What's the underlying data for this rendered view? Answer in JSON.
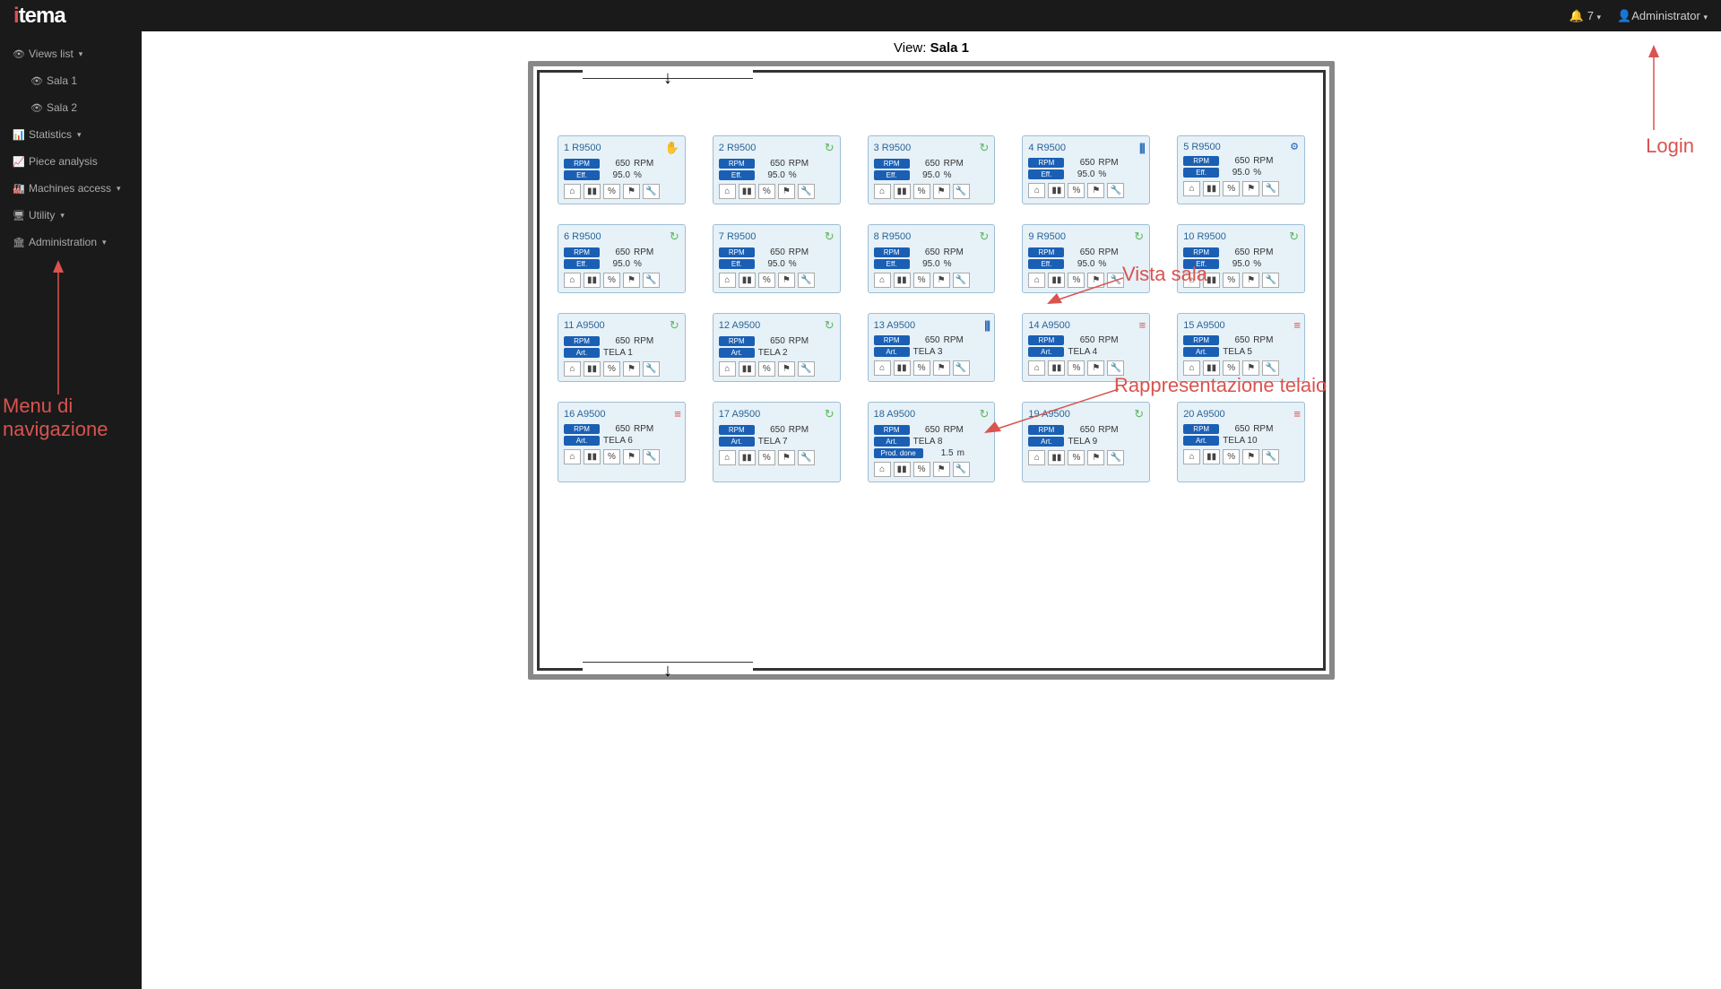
{
  "header": {
    "notif_count": "7",
    "user": "Administrator"
  },
  "sidebar": {
    "views_list": "Views list",
    "sala1": "Sala 1",
    "sala2": "Sala 2",
    "statistics": "Statistics",
    "piece_analysis": "Piece analysis",
    "machines_access": "Machines access",
    "utility": "Utility",
    "administration": "Administration"
  },
  "view": {
    "title_prefix": "View: ",
    "title_name": "Sala 1"
  },
  "labels": {
    "rpm": "RPM",
    "eff": "Eff.",
    "art": "Art.",
    "prod_done": "Prod. done",
    "pct": "%",
    "m": "m"
  },
  "machines": [
    {
      "id": "1 R9500",
      "status": "hand",
      "rows": [
        [
          "rpm",
          "650",
          "RPM"
        ],
        [
          "eff",
          "95.0",
          "%"
        ]
      ]
    },
    {
      "id": "2 R9500",
      "status": "run",
      "rows": [
        [
          "rpm",
          "650",
          "RPM"
        ],
        [
          "eff",
          "95.0",
          "%"
        ]
      ]
    },
    {
      "id": "3 R9500",
      "status": "run",
      "rows": [
        [
          "rpm",
          "650",
          "RPM"
        ],
        [
          "eff",
          "95.0",
          "%"
        ]
      ]
    },
    {
      "id": "4 R9500",
      "status": "bars-blue",
      "rows": [
        [
          "rpm",
          "650",
          "RPM"
        ],
        [
          "eff",
          "95.0",
          "%"
        ]
      ]
    },
    {
      "id": "5 R9500",
      "status": "cfg",
      "rows": [
        [
          "rpm",
          "650",
          "RPM"
        ],
        [
          "eff",
          "95.0",
          "%"
        ]
      ]
    },
    {
      "id": "6 R9500",
      "status": "run",
      "rows": [
        [
          "rpm",
          "650",
          "RPM"
        ],
        [
          "eff",
          "95.0",
          "%"
        ]
      ]
    },
    {
      "id": "7 R9500",
      "status": "run",
      "rows": [
        [
          "rpm",
          "650",
          "RPM"
        ],
        [
          "eff",
          "95.0",
          "%"
        ]
      ]
    },
    {
      "id": "8 R9500",
      "status": "run",
      "rows": [
        [
          "rpm",
          "650",
          "RPM"
        ],
        [
          "eff",
          "95.0",
          "%"
        ]
      ]
    },
    {
      "id": "9 R9500",
      "status": "run",
      "rows": [
        [
          "rpm",
          "650",
          "RPM"
        ],
        [
          "eff",
          "95.0",
          "%"
        ]
      ]
    },
    {
      "id": "10 R9500",
      "status": "run",
      "rows": [
        [
          "rpm",
          "650",
          "RPM"
        ],
        [
          "eff",
          "95.0",
          "%"
        ]
      ]
    },
    {
      "id": "11 A9500",
      "status": "run",
      "rows": [
        [
          "rpm",
          "650",
          "RPM"
        ],
        [
          "art",
          "TELA 1",
          ""
        ]
      ]
    },
    {
      "id": "12 A9500",
      "status": "run",
      "rows": [
        [
          "rpm",
          "650",
          "RPM"
        ],
        [
          "art",
          "TELA 2",
          ""
        ]
      ]
    },
    {
      "id": "13 A9500",
      "status": "bars-blue",
      "rows": [
        [
          "rpm",
          "650",
          "RPM"
        ],
        [
          "art",
          "TELA 3",
          ""
        ]
      ]
    },
    {
      "id": "14 A9500",
      "status": "bars-red",
      "rows": [
        [
          "rpm",
          "650",
          "RPM"
        ],
        [
          "art",
          "TELA 4",
          ""
        ]
      ]
    },
    {
      "id": "15 A9500",
      "status": "bars-red",
      "rows": [
        [
          "rpm",
          "650",
          "RPM"
        ],
        [
          "art",
          "TELA 5",
          ""
        ]
      ]
    },
    {
      "id": "16 A9500",
      "status": "bars-red",
      "rows": [
        [
          "rpm",
          "650",
          "RPM"
        ],
        [
          "art",
          "TELA 6",
          ""
        ]
      ]
    },
    {
      "id": "17 A9500",
      "status": "run",
      "rows": [
        [
          "rpm",
          "650",
          "RPM"
        ],
        [
          "art",
          "TELA 7",
          ""
        ]
      ]
    },
    {
      "id": "18 A9500",
      "status": "run",
      "rows": [
        [
          "rpm",
          "650",
          "RPM"
        ],
        [
          "art",
          "TELA 8",
          ""
        ],
        [
          "prod",
          "1.5",
          "m"
        ]
      ]
    },
    {
      "id": "19 A9500",
      "status": "run",
      "rows": [
        [
          "rpm",
          "650",
          "RPM"
        ],
        [
          "art",
          "TELA 9",
          ""
        ]
      ]
    },
    {
      "id": "20 A9500",
      "status": "bars-red",
      "rows": [
        [
          "rpm",
          "650",
          "RPM"
        ],
        [
          "art",
          "TELA 10",
          ""
        ]
      ]
    }
  ],
  "annotations": {
    "login": "Login",
    "vista_sala": "Vista sala",
    "rappresentazione": "Rappresentazione telaio",
    "menu_nav": "Menu di\nnavigazione"
  }
}
